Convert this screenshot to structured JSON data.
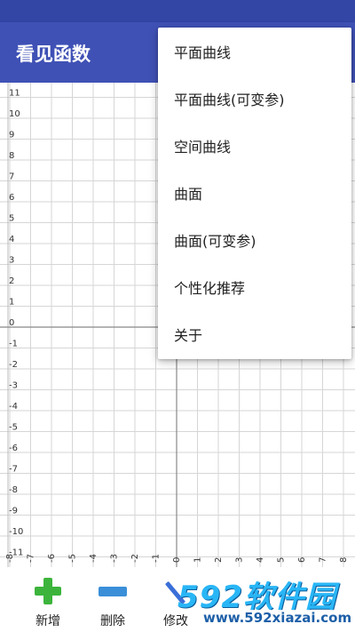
{
  "app": {
    "title": "看见函数"
  },
  "menu": {
    "items": [
      {
        "label": "平面曲线"
      },
      {
        "label": "平面曲线(可变参)"
      },
      {
        "label": "空间曲线"
      },
      {
        "label": "曲面"
      },
      {
        "label": "曲面(可变参)"
      },
      {
        "label": "个性化推荐"
      },
      {
        "label": "关于"
      }
    ]
  },
  "graph": {
    "y_labels": [
      "11",
      "10",
      "9",
      "8",
      "7",
      "6",
      "5",
      "4",
      "3",
      "2",
      "1",
      "0",
      "-1",
      "-2",
      "-3",
      "-4",
      "-5",
      "-6",
      "-7",
      "-8",
      "-9",
      "-10",
      "-11"
    ],
    "x_labels": [
      "-8",
      "-7",
      "-6",
      "-5",
      "-4",
      "-3",
      "-2",
      "-1",
      "0",
      "1",
      "2",
      "3",
      "4",
      "5",
      "6",
      "7",
      "8"
    ]
  },
  "toolbar": {
    "add_label": "新增",
    "delete_label": "删除",
    "edit_label": "修改"
  },
  "watermark": {
    "brand": "592软件园",
    "url": "www.592xiazai.com"
  },
  "colors": {
    "app_bar": "#3f51b5",
    "status_bar": "#3346a6",
    "grid_line": "#d6d6d6",
    "axis_line": "#888888"
  }
}
